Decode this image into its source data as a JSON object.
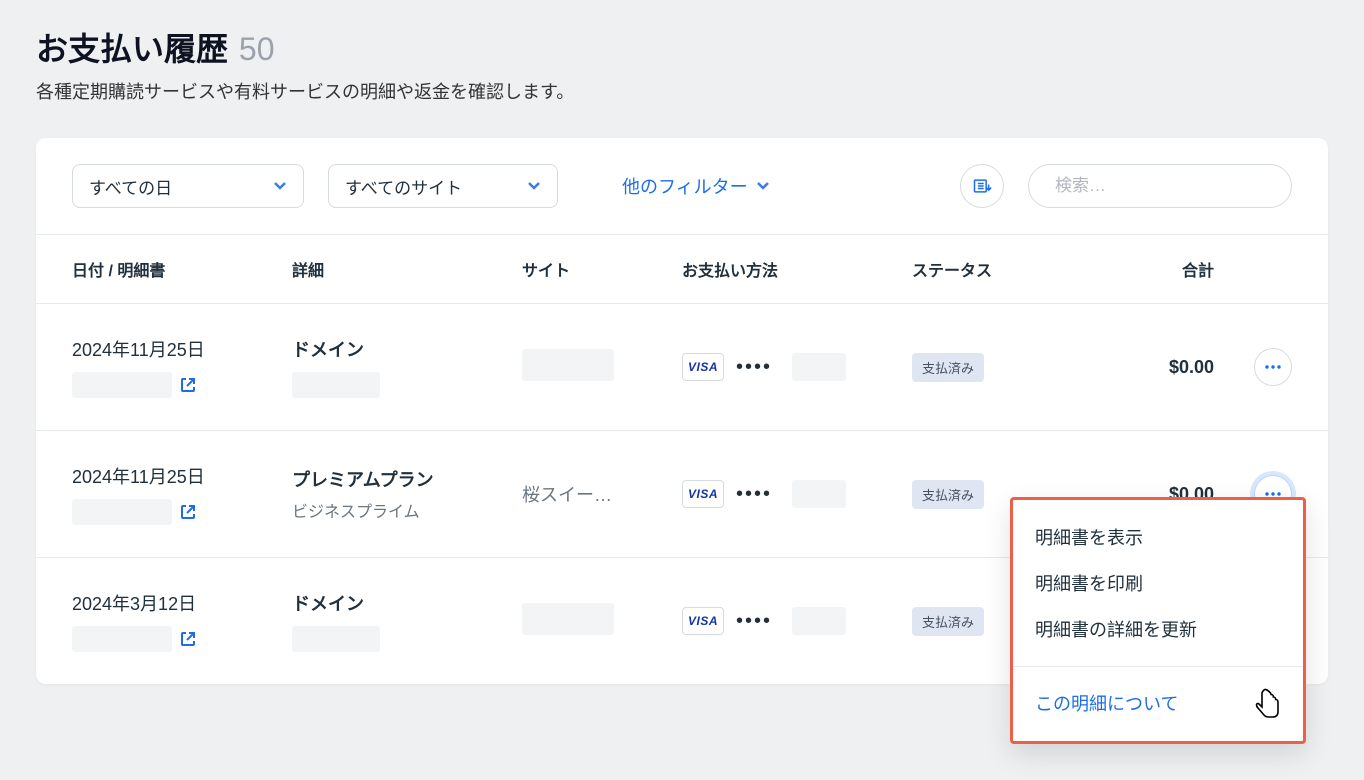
{
  "header": {
    "title": "お支払い履歴",
    "count": "50",
    "subtitle": "各種定期購読サービスや有料サービスの明細や返金を確認します。"
  },
  "filters": {
    "date_filter": "すべての日",
    "site_filter": "すべてのサイト",
    "other_filters": "他のフィルター",
    "search_placeholder": "検索…"
  },
  "columns": {
    "date": "日付 / 明細書",
    "detail": "詳細",
    "site": "サイト",
    "payment": "お支払い方法",
    "status": "ステータス",
    "total": "合計"
  },
  "rows": [
    {
      "date": "2024年11月25日",
      "detail_main": "ドメイン",
      "detail_sub": "",
      "site": "",
      "payment_brand": "VISA",
      "payment_mask": "••••",
      "status": "支払済み",
      "total": "$0.00"
    },
    {
      "date": "2024年11月25日",
      "detail_main": "プレミアムプラン",
      "detail_sub": "ビジネスプライム",
      "site": "桜スイー…",
      "payment_brand": "VISA",
      "payment_mask": "••••",
      "status": "支払済み",
      "total": "$0.00"
    },
    {
      "date": "2024年3月12日",
      "detail_main": "ドメイン",
      "detail_sub": "",
      "site": "",
      "payment_brand": "VISA",
      "payment_mask": "••••",
      "status": "支払済み",
      "total": ""
    }
  ],
  "menu": {
    "view": "明細書を表示",
    "print": "明細書を印刷",
    "update": "明細書の詳細を更新",
    "about": "この明細について"
  }
}
